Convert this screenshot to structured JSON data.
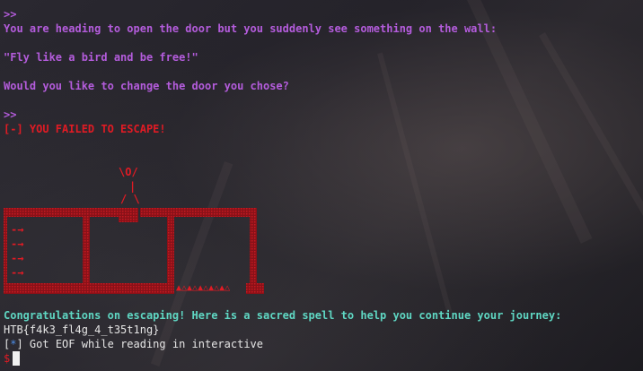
{
  "terminal": {
    "prompt1": ">>",
    "line_wall": "You are heading to open the door but you suddenly see something on the wall:",
    "line_quote": "\"Fly like a bird and be free!\"",
    "line_question": "Would you like to change the door you chose?",
    "prompt2": ">>",
    "fail": "[-] YOU FAILED TO ESCAPE!",
    "figure_head": "\\O/",
    "figure_body": "|",
    "figure_legs": "/ \\",
    "arrow": "-→",
    "spikes": "▲△▲△▲△▲△▲△",
    "congrats": "Congratulations on escaping! Here is a sacred spell to help you continue your journey:",
    "flag": "HTB{f4k3_fl4g_4_t35t1ng}",
    "eof_prefix": "[",
    "eof_star": "*",
    "eof_text": "] Got EOF while reading in interactive",
    "shell_prompt": "$"
  },
  "colors": {
    "purple": "#b45cdc",
    "red": "#e01b24",
    "teal": "#5fd7c3",
    "blue": "#4d8fe8",
    "white": "#e6e6e6"
  }
}
